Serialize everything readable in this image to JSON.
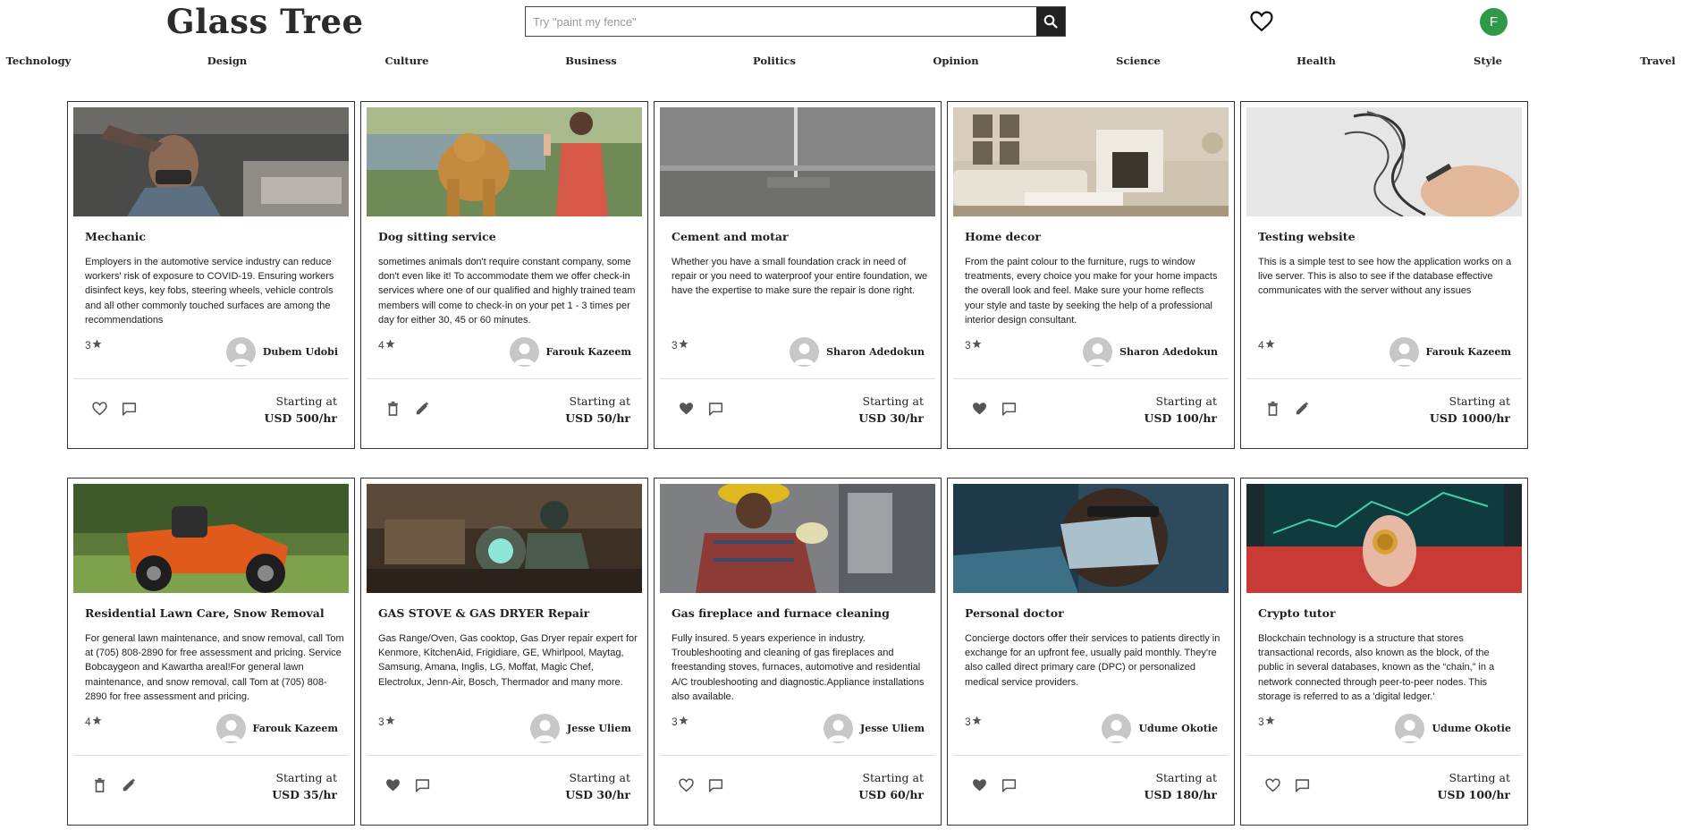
{
  "header": {
    "logo": "Glass Tree",
    "search_placeholder": "Try \"paint my fence\"",
    "avatar_initial": "F",
    "avatar_color": "#2e9a48"
  },
  "categories": [
    "Technology",
    "Design",
    "Culture",
    "Business",
    "Politics",
    "Opinion",
    "Science",
    "Health",
    "Style",
    "Travel"
  ],
  "price_prefix": "Starting at",
  "cards": [
    {
      "title": "Mechanic",
      "desc": "Employers in the automotive service industry can reduce workers' risk of exposure to COVID-19. Ensuring workers disinfect keys, key fobs, steering wheels, vehicle controls and all other commonly touched surfaces are among the recommendations",
      "rating": "3",
      "owner": "Dubem Udobi",
      "price": "USD 500/hr",
      "actions": [
        "heart-outline",
        "comment"
      ]
    },
    {
      "title": "Dog sitting service",
      "desc": "sometimes animals don't require constant company, some don't even like it! To accommodate them we offer check-in services where one of our qualified and highly trained team members will come to check-in on your pet 1 - 3 times per day for either 30, 45 or 60 minutes.",
      "rating": "4",
      "owner": "Farouk Kazeem",
      "price": "USD 50/hr",
      "actions": [
        "trash",
        "edit"
      ]
    },
    {
      "title": "Cement and motar",
      "desc": "Whether you have a small foundation crack in need of repair or you need to waterproof your entire foundation, we have the expertise to make sure the repair is done right.",
      "rating": "3",
      "owner": "Sharon Adedokun",
      "price": "USD 30/hr",
      "actions": [
        "heart-filled",
        "comment"
      ]
    },
    {
      "title": "Home decor",
      "desc": "From the paint colour to the furniture, rugs to window treatments, every choice you make for your home impacts the overall look and feel. Make sure your home reflects your style and taste by seeking the help of a professional interior design consultant.",
      "rating": "3",
      "owner": "Sharon Adedokun",
      "price": "USD 100/hr",
      "actions": [
        "heart-filled",
        "comment"
      ]
    },
    {
      "title": "Testing website",
      "desc": "This is a simple test to see how the application works on a live server. This is also to see if the database effective communicates with the server without any issues",
      "rating": "4",
      "owner": "Farouk Kazeem",
      "price": "USD 1000/hr",
      "actions": [
        "trash",
        "edit"
      ]
    },
    {
      "title": "Residential Lawn Care, Snow Removal",
      "desc": "For general lawn maintenance, and snow removal, call Tom at (705) 808-2890 for free assessment and pricing. Service Bobcaygeon and Kawartha areal!For general lawn maintenance, and snow removal, call Tom at (705) 808-2890 for free assessment and pricing.",
      "rating": "4",
      "owner": "Farouk Kazeem",
      "price": "USD 35/hr",
      "actions": [
        "trash",
        "edit"
      ]
    },
    {
      "title": "GAS STOVE & GAS DRYER Repair",
      "desc": "Gas Range/Oven, Gas cooktop, Gas Dryer repair expert for Kenmore, KitchenAid, Frigidiare, GE, Whirlpool, Maytag, Samsung, Amana, Inglis, LG, Moffat, Magic Chef, Electrolux, Jenn-Air, Bosch, Thermador and many more.",
      "rating": "3",
      "owner": "Jesse Uliem",
      "price": "USD 30/hr",
      "actions": [
        "heart-filled",
        "comment"
      ]
    },
    {
      "title": "Gas fireplace and furnace cleaning",
      "desc": "Fully insured. 5 years experience in industry. Troubleshooting and cleaning of gas fireplaces and freestanding stoves, furnaces, automotive and residential A/C troubleshooting and diagnostic.Appliance installations also available.",
      "rating": "3",
      "owner": "Jesse Uliem",
      "price": "USD 60/hr",
      "actions": [
        "heart-outline",
        "comment"
      ]
    },
    {
      "title": "Personal doctor",
      "desc": "Concierge doctors offer their services to patients directly in exchange for an upfront fee, usually paid monthly. They're also called direct primary care (DPC) or personalized medical service providers.",
      "rating": "3",
      "owner": "Udume Okotie",
      "price": "USD 180/hr",
      "actions": [
        "heart-filled",
        "comment"
      ]
    },
    {
      "title": "Crypto tutor",
      "desc": "Blockchain technology is a structure that stores transactional records, also known as the block, of the public in several databases, known as the “chain,” in a network connected through peer-to-peer nodes. This storage is referred to as a 'digital ledger.'",
      "rating": "3",
      "owner": "Udume Okotie",
      "price": "USD 100/hr",
      "actions": [
        "heart-outline",
        "comment"
      ]
    }
  ]
}
